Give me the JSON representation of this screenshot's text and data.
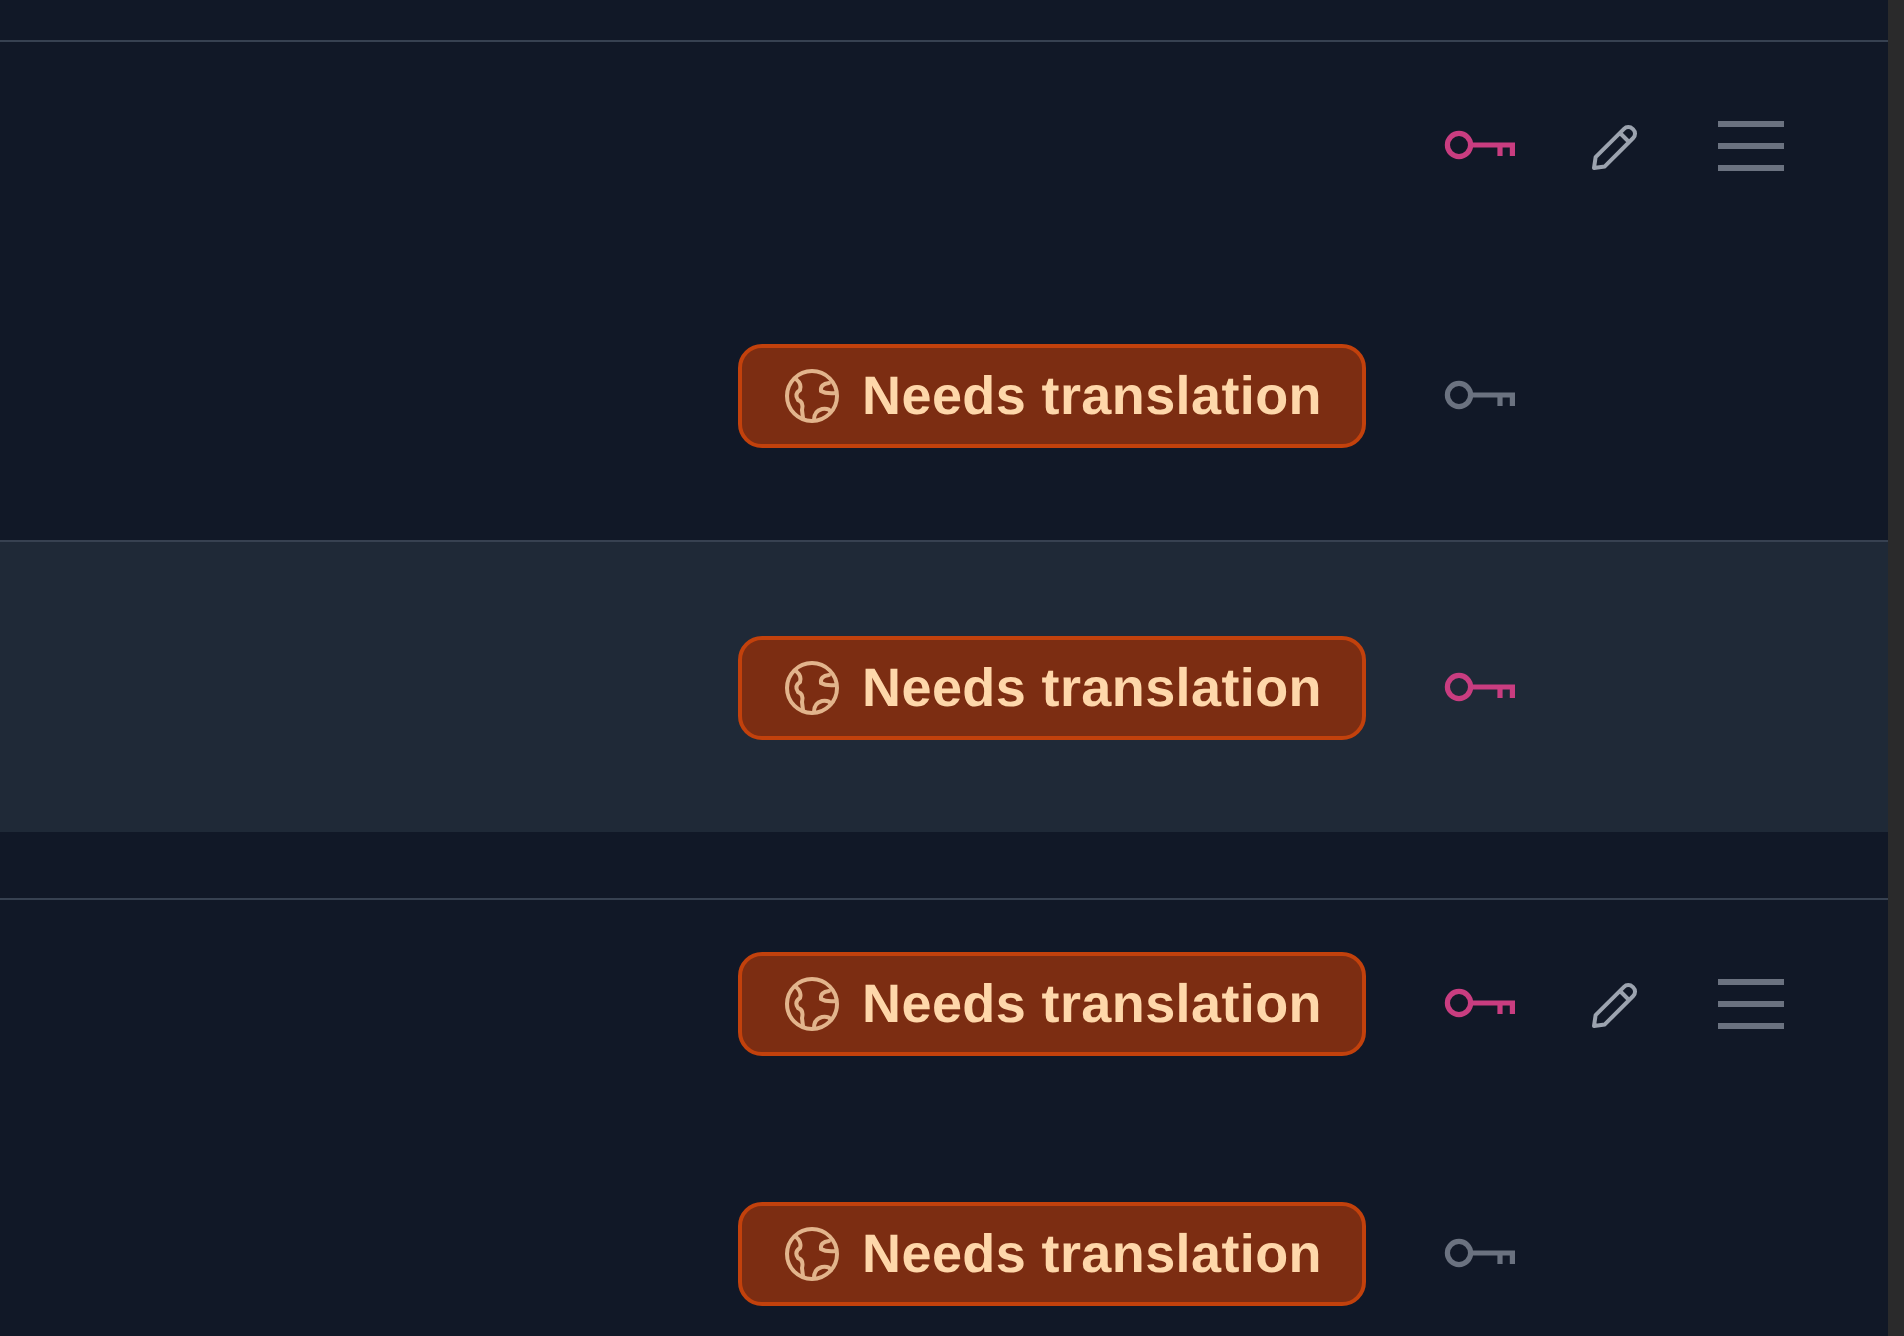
{
  "groups": [
    {
      "rows": [
        {
          "kind": "header",
          "selected": false,
          "key_on": true,
          "actions": [
            {
              "kind": "edit"
            },
            {
              "kind": "menu"
            }
          ]
        },
        {
          "kind": "item",
          "selected": false,
          "badge": "Needs translation",
          "key_on": false
        }
      ]
    },
    {
      "rows": [
        {
          "kind": "item",
          "selected": true,
          "badge": "Needs translation",
          "key_on": true
        }
      ]
    },
    {
      "rows": [
        {
          "kind": "header",
          "selected": false,
          "badge": "Needs translation",
          "key_on": true,
          "actions": [
            {
              "kind": "edit"
            },
            {
              "kind": "menu"
            }
          ]
        },
        {
          "kind": "item",
          "selected": false,
          "badge": "Needs translation",
          "key_on": false
        }
      ]
    }
  ]
}
